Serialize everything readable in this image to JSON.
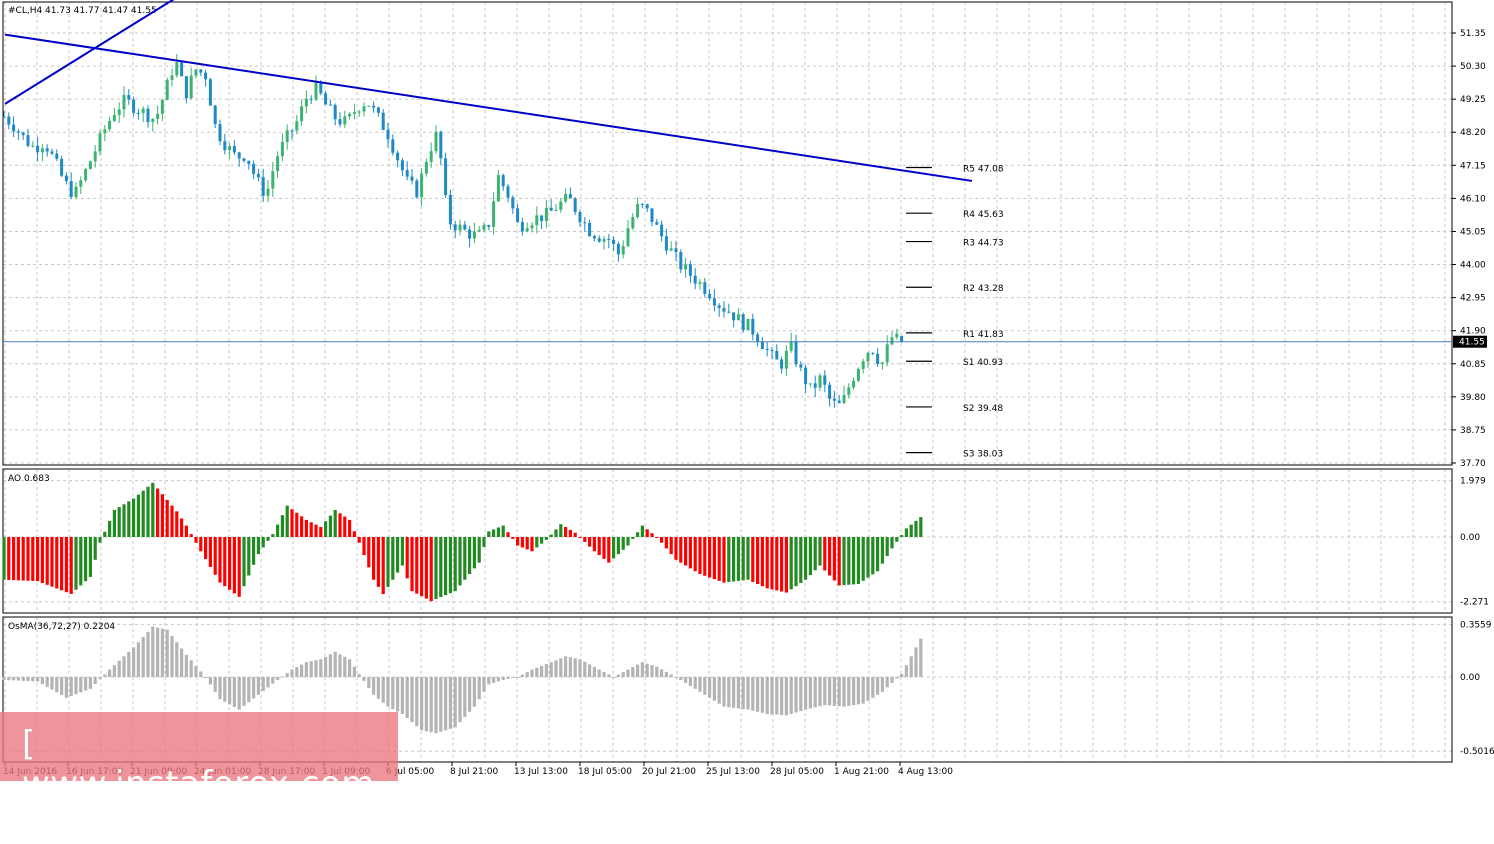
{
  "chart_data": [
    {
      "type": "candlestick",
      "panel": "price",
      "header": "#CL,H4  41.73 41.77 41.47 41.55",
      "symbol": "#CL",
      "timeframe": "H4",
      "ohlc": {
        "open": 41.73,
        "high": 41.77,
        "low": 41.47,
        "close": 41.55
      },
      "current_price": "41.55",
      "y_ticks": [
        "51.35",
        "50.30",
        "49.25",
        "48.20",
        "47.15",
        "46.10",
        "45.05",
        "44.00",
        "42.95",
        "41.90",
        "40.85",
        "39.80",
        "38.75",
        "37.70"
      ],
      "ylim": [
        37.7,
        51.35
      ],
      "x_ticks": [
        "14 Jun 2016",
        "16 Jun 17:00",
        "21 Jun 09:00",
        "24 Jun 01:00",
        "28 Jun 17:00",
        "1 Jul 09:00",
        "6 Jul 05:00",
        "8 Jul 21:00",
        "13 Jul 13:00",
        "18 Jul 05:00",
        "20 Jul 21:00",
        "25 Jul 13:00",
        "28 Jul 05:00",
        "1 Aug 21:00",
        "4 Aug 13:00"
      ],
      "close_path": [
        48.7,
        48.4,
        48.0,
        47.7,
        47.9,
        47.3,
        46.6,
        46.2,
        46.9,
        47.6,
        48.3,
        48.9,
        49.2,
        49.0,
        48.8,
        48.6,
        49.5,
        50.5,
        49.4,
        50.2,
        50.0,
        48.3,
        47.8,
        47.4,
        47.5,
        46.7,
        46.2,
        47.4,
        48.0,
        48.5,
        49.3,
        49.6,
        49.0,
        48.6,
        48.5,
        49.0,
        49.2,
        48.7,
        48.2,
        47.4,
        46.6,
        46.3,
        47.5,
        48.2,
        45.4,
        45.2,
        45.0,
        44.9,
        45.2,
        46.8,
        46.2,
        45.2,
        45.4,
        45.5,
        45.6,
        45.9,
        46.1,
        45.6,
        45.1,
        44.9,
        44.8,
        44.3,
        45.3,
        45.9,
        45.6,
        45.0,
        44.5,
        44.0,
        43.7,
        43.4,
        43.1,
        42.7,
        42.5,
        42.2,
        42.0,
        41.6,
        41.1,
        40.8,
        41.4,
        40.6,
        40.0,
        40.4,
        39.6,
        39.5,
        40.3,
        41.0,
        41.4,
        40.8,
        41.7,
        41.55
      ]
    },
    {
      "type": "levels",
      "panel": "price",
      "levels": [
        {
          "label": "R5",
          "value": 47.08,
          "text": "R5 47.08"
        },
        {
          "label": "R4",
          "value": 45.63,
          "text": "R4 45.63"
        },
        {
          "label": "R3",
          "value": 44.73,
          "text": "R3 44.73"
        },
        {
          "label": "R2",
          "value": 43.28,
          "text": "R2 43.28"
        },
        {
          "label": "R1",
          "value": 41.83,
          "text": "R1 41.83"
        },
        {
          "label": "S1",
          "value": 40.93,
          "text": "S1 40.93"
        },
        {
          "label": "S2",
          "value": 39.48,
          "text": "S2 39.48"
        },
        {
          "label": "S3",
          "value": 38.03,
          "text": "S3 38.03"
        }
      ],
      "trendlines": [
        {
          "name": "descending",
          "from": {
            "x": "14 Jun 2016",
            "y": 51.3
          },
          "to": {
            "x": "4 Aug 13:00",
            "y": 47.0
          },
          "color": "#0000c8"
        },
        {
          "name": "ascending",
          "from": {
            "x": "14 Jun 2016",
            "y": 49.1
          },
          "to": {
            "x": "21 Jun 09:00",
            "y": 51.6
          },
          "color": "#0000c8"
        }
      ]
    },
    {
      "type": "bar",
      "panel": "AO",
      "header": "AO 0.683",
      "name": "AO",
      "value": 0.683,
      "y_ticks": [
        "1.979",
        "0.00",
        "-2.271"
      ],
      "ylim": [
        -2.271,
        1.979
      ],
      "keyframes": [
        [
          0,
          -1.5
        ],
        [
          7,
          -1.55
        ],
        [
          14,
          -2.0
        ],
        [
          18,
          -1.4
        ],
        [
          20,
          -0.2
        ],
        [
          23,
          0.95
        ],
        [
          27,
          1.35
        ],
        [
          31,
          1.9
        ],
        [
          36,
          0.9
        ],
        [
          38,
          0.4
        ],
        [
          41,
          -0.5
        ],
        [
          45,
          -1.6
        ],
        [
          49,
          -2.1
        ],
        [
          53,
          -0.6
        ],
        [
          56,
          0.1
        ],
        [
          59,
          1.1
        ],
        [
          63,
          0.6
        ],
        [
          66,
          0.35
        ],
        [
          69,
          0.95
        ],
        [
          72,
          0.6
        ],
        [
          74,
          -0.2
        ],
        [
          77,
          -1.5
        ],
        [
          79,
          -2.0
        ],
        [
          83,
          -1.0
        ],
        [
          85,
          -1.9
        ],
        [
          89,
          -2.25
        ],
        [
          94,
          -1.9
        ],
        [
          99,
          -0.9
        ],
        [
          101,
          0.2
        ],
        [
          104,
          0.4
        ],
        [
          107,
          -0.3
        ],
        [
          110,
          -0.5
        ],
        [
          113,
          -0.1
        ],
        [
          116,
          0.45
        ],
        [
          119,
          0.15
        ],
        [
          123,
          -0.5
        ],
        [
          126,
          -0.9
        ],
        [
          130,
          -0.3
        ],
        [
          133,
          0.4
        ],
        [
          136,
          0.0
        ],
        [
          140,
          -0.8
        ],
        [
          145,
          -1.3
        ],
        [
          150,
          -1.6
        ],
        [
          155,
          -1.5
        ],
        [
          159,
          -1.8
        ],
        [
          163,
          -1.95
        ],
        [
          167,
          -1.5
        ],
        [
          170,
          -1.0
        ],
        [
          174,
          -1.7
        ],
        [
          178,
          -1.65
        ],
        [
          182,
          -1.2
        ],
        [
          185,
          -0.4
        ],
        [
          188,
          0.3
        ],
        [
          191,
          0.7
        ]
      ]
    },
    {
      "type": "bar",
      "panel": "OsMA",
      "header": "OsMA(36,72,27) 0.2204",
      "name": "OsMA(36,72,27)",
      "value": 0.2204,
      "y_ticks": [
        "0.3559",
        "0.00",
        "-0.5016"
      ],
      "ylim": [
        -0.5016,
        0.3559
      ],
      "keyframes": [
        [
          0,
          -0.02
        ],
        [
          7,
          -0.03
        ],
        [
          13,
          -0.14
        ],
        [
          18,
          -0.08
        ],
        [
          22,
          0.05
        ],
        [
          27,
          0.2
        ],
        [
          31,
          0.34
        ],
        [
          34,
          0.32
        ],
        [
          38,
          0.15
        ],
        [
          42,
          0.0
        ],
        [
          45,
          -0.15
        ],
        [
          49,
          -0.22
        ],
        [
          53,
          -0.12
        ],
        [
          57,
          -0.02
        ],
        [
          60,
          0.05
        ],
        [
          63,
          0.1
        ],
        [
          66,
          0.12
        ],
        [
          69,
          0.17
        ],
        [
          72,
          0.12
        ],
        [
          74,
          0.02
        ],
        [
          77,
          -0.12
        ],
        [
          80,
          -0.2
        ],
        [
          83,
          -0.25
        ],
        [
          87,
          -0.36
        ],
        [
          90,
          -0.38
        ],
        [
          94,
          -0.34
        ],
        [
          98,
          -0.2
        ],
        [
          101,
          -0.05
        ],
        [
          104,
          -0.02
        ],
        [
          107,
          0.0
        ],
        [
          110,
          0.05
        ],
        [
          114,
          0.1
        ],
        [
          117,
          0.14
        ],
        [
          120,
          0.12
        ],
        [
          124,
          0.05
        ],
        [
          127,
          0.0
        ],
        [
          130,
          0.05
        ],
        [
          133,
          0.1
        ],
        [
          136,
          0.07
        ],
        [
          140,
          0.0
        ],
        [
          145,
          -0.1
        ],
        [
          150,
          -0.2
        ],
        [
          155,
          -0.22
        ],
        [
          159,
          -0.25
        ],
        [
          163,
          -0.26
        ],
        [
          167,
          -0.22
        ],
        [
          171,
          -0.19
        ],
        [
          175,
          -0.2
        ],
        [
          179,
          -0.18
        ],
        [
          183,
          -0.1
        ],
        [
          187,
          0.02
        ],
        [
          190,
          0.2
        ],
        [
          191,
          0.26
        ]
      ]
    }
  ],
  "colors": {
    "bull": "#228b22",
    "bear": "#ff0000",
    "candle_bull": "#3cb371",
    "candle_bear": "#1e88c8",
    "trendline": "#0000c8",
    "grid": "#c8c8c8",
    "price_line": "#4a7fbf",
    "osma": "#b4b4b4"
  },
  "watermark": "[ www.instaforex.com ]"
}
